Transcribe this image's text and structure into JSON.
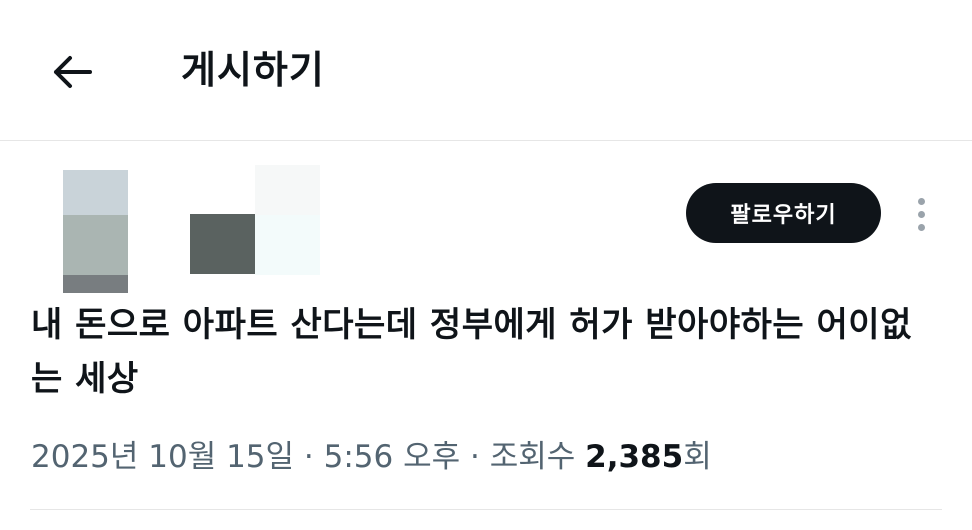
{
  "header": {
    "title": "게시하기"
  },
  "post": {
    "follow_label": "팔로우하기",
    "text": "내 돈으로 아파트 산다는데 정부에게 허가 받아야하는 어이없는 세상",
    "date": "2025년 10월 15일",
    "separator": " · ",
    "time": "5:56 오후",
    "views_label": "조회수",
    "views_count": "2,385",
    "views_suffix": "회"
  },
  "colors": {
    "text_primary": "#0f1419",
    "text_secondary": "#536471",
    "follow_button_bg": "#0f1419",
    "divider": "#e6e6e6"
  }
}
